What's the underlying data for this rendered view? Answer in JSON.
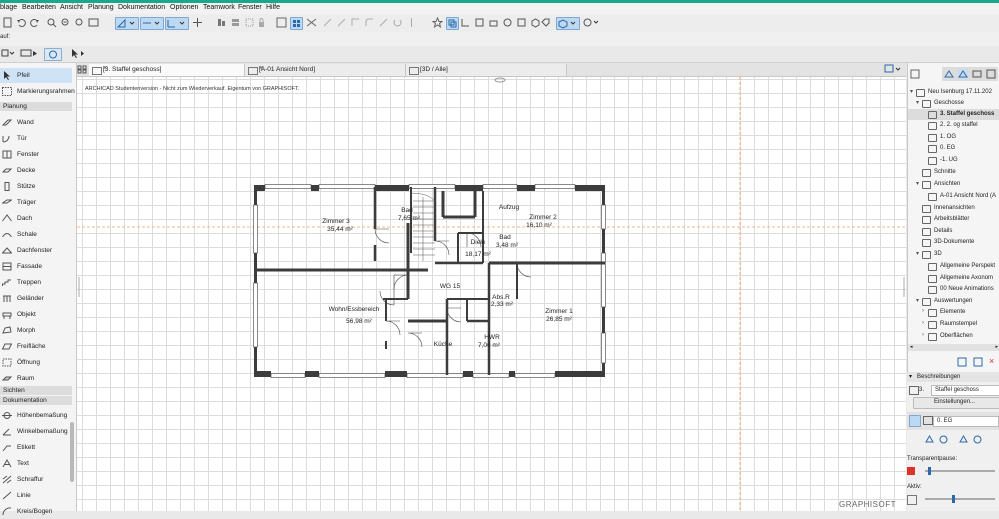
{
  "menu": [
    "blage",
    "Bearbeiten",
    "Ansicht",
    "Planung",
    "Dokumentation",
    "Optionen",
    "Teamwork",
    "Fenster",
    "Hilfe"
  ],
  "toolbar2_label": "auf:",
  "palette": {
    "pfeil": "Pfeil",
    "marquee": "Markierungsrahmen",
    "sec_planung": "Planung",
    "planung": [
      "Wand",
      "Tür",
      "Fenster",
      "Decke",
      "Stütze",
      "Träger",
      "Dach",
      "Schale",
      "Dachfenster",
      "Fassade",
      "Treppen",
      "Geländer",
      "Objekt",
      "Morph",
      "Freifläche",
      "Öffnung",
      "Raum"
    ],
    "sec_sichten": "Sichten",
    "sec_doku": "Dokumentation",
    "dokumentation": [
      "Höhenbemaßung",
      "Winkelbemaßung",
      "Etikett",
      "Text",
      "Schraffur",
      "Linie",
      "Kreis/Bogen"
    ]
  },
  "tabs": [
    {
      "label": "[3. Staffel geschoss]",
      "close": "×"
    },
    {
      "label": "[A-01 Ansicht Nord]",
      "close": "×"
    },
    {
      "label": "[3D / Alle]",
      "close": ""
    }
  ],
  "canvas": {
    "notice": "ARCHICAD Studentenversion - Nicht zum Wiederverkauf. Eigentum von GRAPHISOFT.",
    "brand": "GRAPHISOFT"
  },
  "rooms": [
    {
      "name": "Zimmer 3",
      "area": "35,44 m²"
    },
    {
      "name": "Bad",
      "area": "7,65 m²"
    },
    {
      "name": "Aufzug",
      "area": ""
    },
    {
      "name": "Zimmer 2",
      "area": "16,10 m²"
    },
    {
      "name": "Diele",
      "area": "18,17 m²"
    },
    {
      "name": "Bad",
      "area": "3,48 m²"
    },
    {
      "name": "WG 15",
      "area": ""
    },
    {
      "name": "Wohn/Essbereich",
      "area": "56,98 m²"
    },
    {
      "name": "Abs.R",
      "area": "2,33 m²"
    },
    {
      "name": "Zimmer 1",
      "area": "26,85 m²"
    },
    {
      "name": "Küche",
      "area": ""
    },
    {
      "name": "HWR",
      "area": "7,06 m²"
    }
  ],
  "navigator": {
    "project": "Neu Isenburg 17.11.202",
    "geschosse": "Geschosse",
    "floors": [
      "3. Staffel geschoss",
      "2. 2. og staffel",
      "1. OG",
      "0. EG",
      "-1. UG"
    ],
    "schnitte": "Schnitte",
    "ansichten": "Ansichten",
    "ansicht_nord": "A-01 Ansicht Nord (A",
    "innenansichten": "Innenansichten",
    "arbeitsblaetter": "Arbeitsblätter",
    "details": "Details",
    "dokumente3d": "3D-Dokumente",
    "sec3d": "3D",
    "items3d": [
      "Allgemeine Perspekt",
      "Allgemeine Axonom",
      "00 Neue Animations"
    ],
    "auswertungen": "Auswertungen",
    "elemente": "Elemente",
    "raumstempel": "Raumstempel",
    "oberflaechen": "Oberflächen"
  },
  "props": {
    "beschreibungen": "Beschreibungen",
    "floor_num": "3.",
    "floor_name": "Staffel geschoss",
    "settings": "Einstellungen...",
    "layer": "0. EG",
    "transparent_label": "Transparentpause:",
    "aktiv_label": "Aktiv:",
    "transparent_level": 0.05,
    "aktiv_level": 0.4
  },
  "colors": {
    "accent": "#1aa88a",
    "selection": "#cfe3f7",
    "wall": "#3c3c3c",
    "guide": "#f2a06a",
    "swatch": "#e0312b"
  }
}
